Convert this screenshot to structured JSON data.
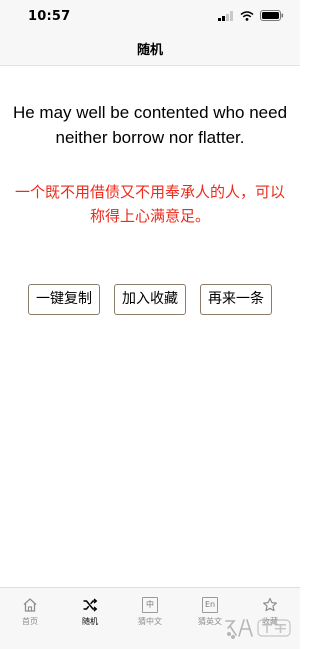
{
  "status_bar": {
    "time": "10:57"
  },
  "nav": {
    "title": "随机"
  },
  "quote": {
    "english": "He may well be contented who need neither borrow nor flatter.",
    "chinese": "一个既不用借债又不用奉承人的人，可以称得上心满意足。"
  },
  "actions": {
    "copy_label": "一键复制",
    "favorite_label": "加入收藏",
    "next_label": "再来一条"
  },
  "tabs": [
    {
      "label": "首页",
      "icon": "home-icon"
    },
    {
      "label": "随机",
      "icon": "shuffle-icon"
    },
    {
      "label": "猜中文",
      "icon": "chinese-char-icon",
      "icon_text": "中"
    },
    {
      "label": "猜英文",
      "icon": "english-icon",
      "icon_text": "En"
    },
    {
      "label": "收藏",
      "icon": "star-icon"
    }
  ],
  "colors": {
    "accent_red": "#ee2a1b",
    "button_border": "#8b7c6c",
    "tab_inactive": "#8e8e93"
  }
}
